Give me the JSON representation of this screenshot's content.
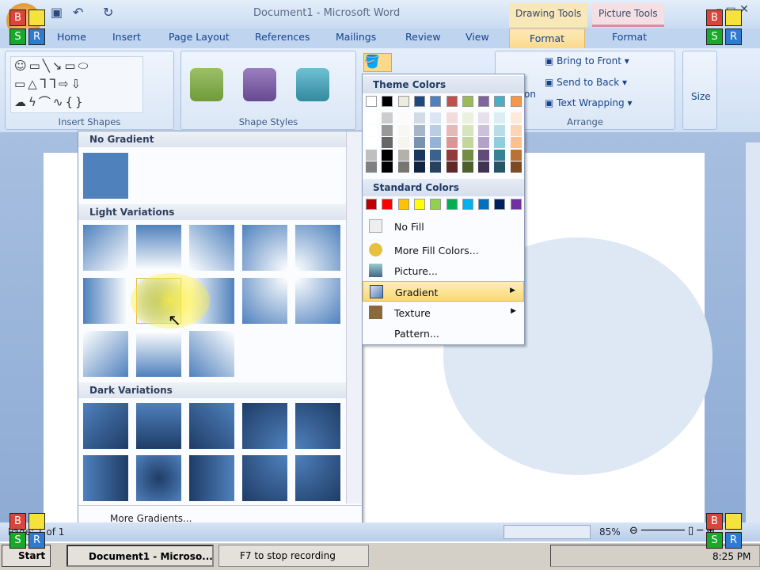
{
  "window": {
    "title": "Document1 - Microsoft Word",
    "context_tabs": [
      "Drawing Tools",
      "Picture Tools"
    ]
  },
  "tabs": [
    "Home",
    "Insert",
    "Page Layout",
    "References",
    "Mailings",
    "Review",
    "View",
    "Format",
    "Format"
  ],
  "groups": {
    "insert_shapes": "Insert Shapes",
    "shape_styles": "Shape Styles",
    "arrange": "Arrange",
    "size": "Size"
  },
  "arrange": {
    "bring_to_front": "Bring to Front",
    "send_to_back": "Send to Back",
    "text_wrapping": "Text Wrapping",
    "position_partial": "on"
  },
  "gallery": {
    "no_gradient": "No Gradient",
    "light": "Light Variations",
    "dark": "Dark Variations",
    "more": "More Gradients..."
  },
  "color_menu": {
    "theme_header": "Theme Colors",
    "theme_colors": [
      "#ffffff",
      "#000000",
      "#eeece1",
      "#1f497d",
      "#4f81bd",
      "#c0504d",
      "#9bbb59",
      "#8064a2",
      "#4bacc6",
      "#f79646"
    ],
    "standard_header": "Standard Colors",
    "standard_colors": [
      "#c00000",
      "#ff0000",
      "#ffc000",
      "#ffff00",
      "#92d050",
      "#00b050",
      "#00b0f0",
      "#0070c0",
      "#002060",
      "#7030a0"
    ],
    "items": [
      {
        "label": "No Fill"
      },
      {
        "label": "More Fill Colors..."
      },
      {
        "label": "Picture..."
      },
      {
        "label": "Gradient"
      },
      {
        "label": "Texture"
      },
      {
        "label": "Pattern..."
      }
    ]
  },
  "status": {
    "page": "Page: 1 of 1",
    "zoom": "85%"
  },
  "taskbar": {
    "start": "Start",
    "items": [
      "Document1 - Microso...",
      "F7 to stop recording"
    ],
    "clock": "8:25 PM"
  },
  "overlay": {
    "b": "B",
    "s": "S",
    "r": "R"
  }
}
